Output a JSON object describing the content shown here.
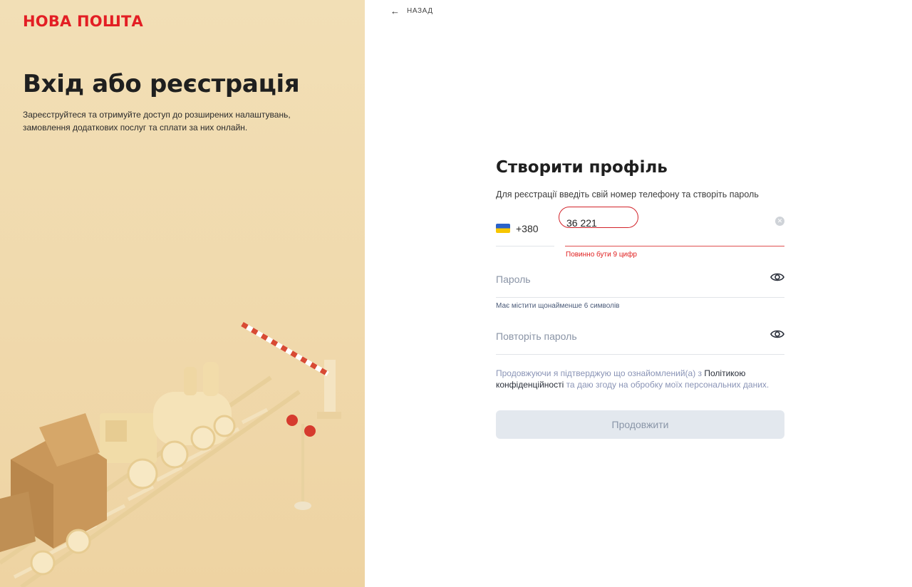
{
  "brand": {
    "logo_text": "НОВА ПОШТА",
    "accent": "#e31e24"
  },
  "hero": {
    "title": "Вхід або реєстрація",
    "subtitle": "Зареєструйтеся та отримуйте доступ до розширених налаштувань, замовлення додаткових послуг та сплати за них онлайн."
  },
  "nav": {
    "back_label": "НАЗАД",
    "back_icon": "arrow-left-icon"
  },
  "form": {
    "title": "Створити профіль",
    "description": "Для реєстрації введіть свій номер телефону та створіть пароль",
    "phone": {
      "country_flag": "ua-flag-icon",
      "country_code": "+380",
      "value": "36 221",
      "error": "Повинно бути 9 цифр",
      "error_color": "#e02020"
    },
    "password": {
      "placeholder": "Пароль",
      "hint": "Має містити щонайменше 6 символів",
      "toggle_icon": "eye-icon"
    },
    "repeat_password": {
      "placeholder": "Повторіть пароль",
      "toggle_icon": "eye-icon"
    },
    "consent": {
      "text_before": "Продовжуючи я підтверджую що ознайомлений(а) з ",
      "link_text": "Політикою конфіденційності",
      "text_after": " та даю згоду на обробку моїх персональних даних."
    },
    "submit_label": "Продовжити"
  }
}
